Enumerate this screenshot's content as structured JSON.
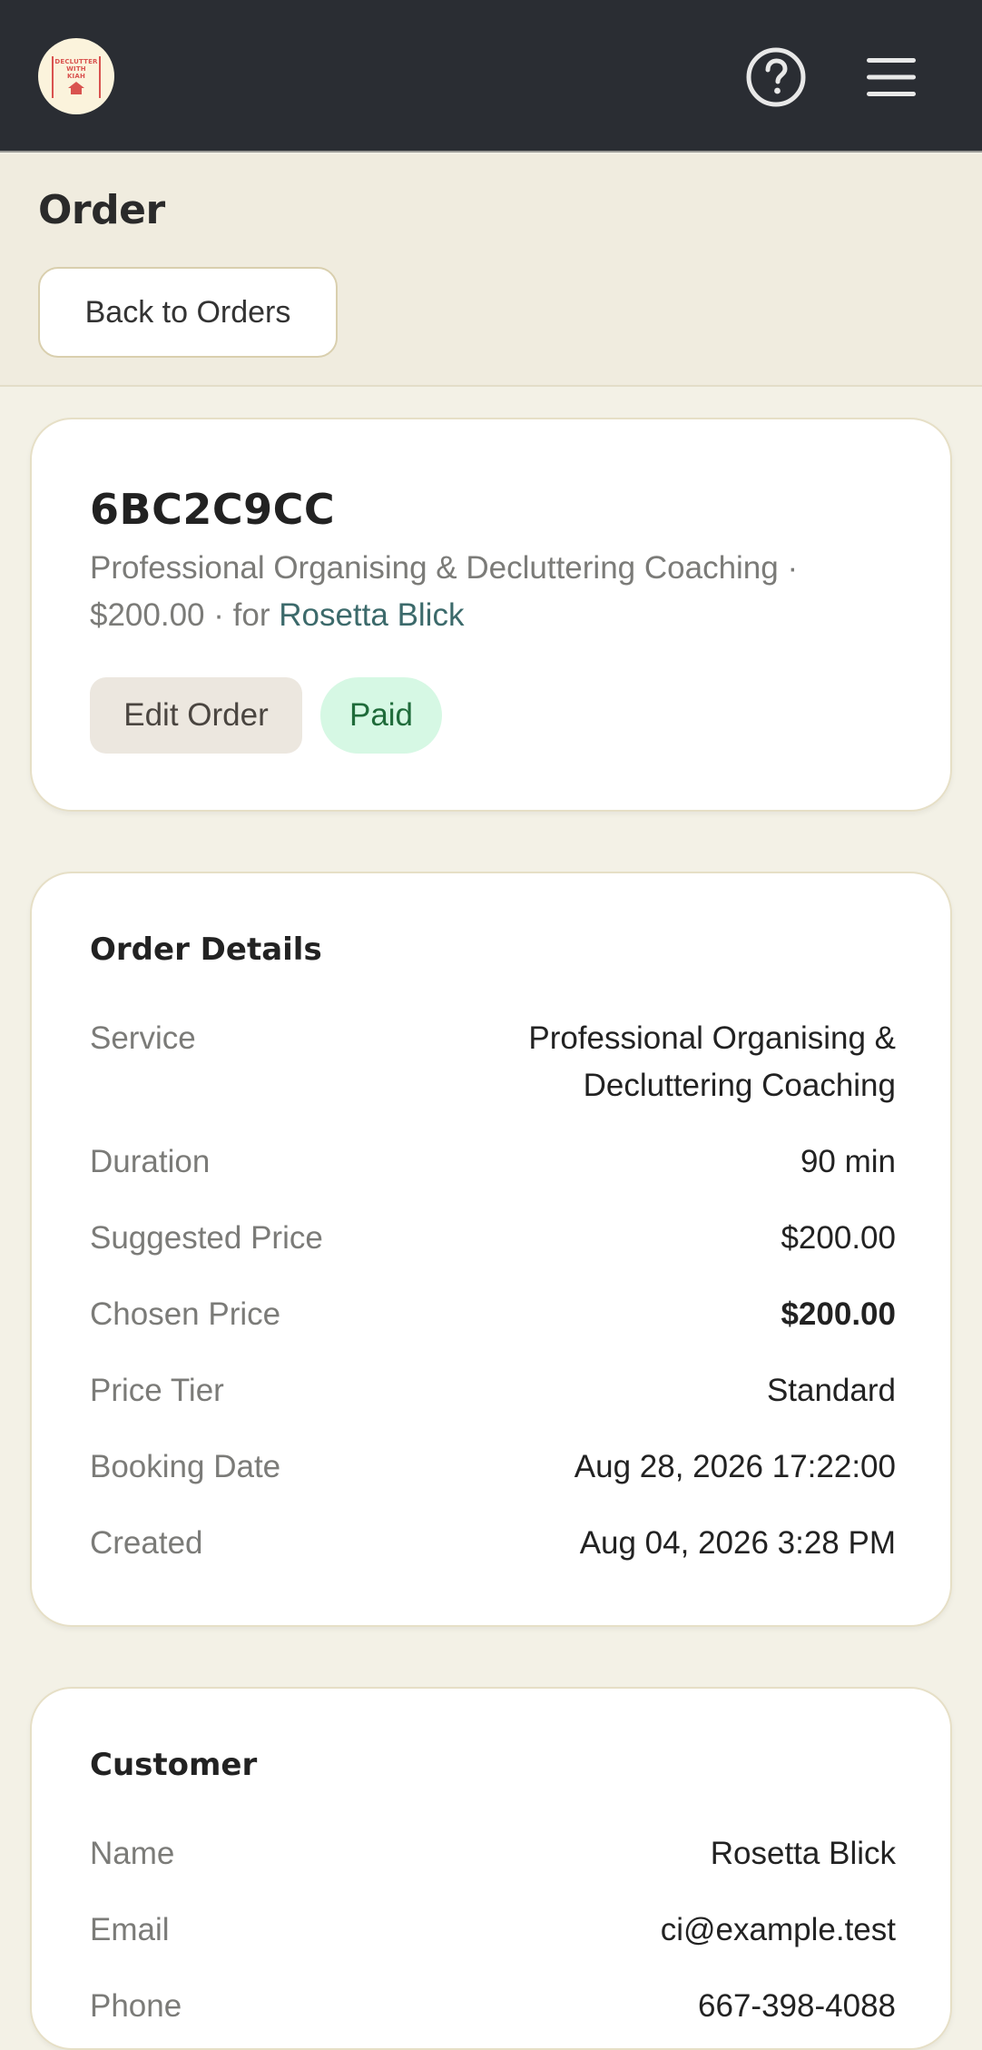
{
  "app": {
    "logo_text": "DECLUTTER WITH KIAH"
  },
  "header": {
    "title": "Order",
    "back_label": "Back to Orders"
  },
  "order": {
    "code": "6BC2C9CC",
    "service": "Professional Organising & Decluttering Coaching",
    "sep1": " · ",
    "price": "$200.00",
    "sep2": " · for ",
    "customer": "Rosetta Blick",
    "edit_label": "Edit Order",
    "status": "Paid"
  },
  "details": {
    "title": "Order Details",
    "rows": [
      {
        "label": "Service",
        "value": "Professional Organising & Decluttering Coaching"
      },
      {
        "label": "Duration",
        "value": "90 min"
      },
      {
        "label": "Suggested Price",
        "value": "$200.00"
      },
      {
        "label": "Chosen Price",
        "value": "$200.00"
      },
      {
        "label": "Price Tier",
        "value": "Standard"
      },
      {
        "label": "Booking Date",
        "value": "Aug 28, 2026 17:22:00"
      },
      {
        "label": "Created",
        "value": "Aug 04, 2026 3:28 PM"
      }
    ]
  },
  "customer": {
    "title": "Customer",
    "rows": [
      {
        "label": "Name",
        "value": "Rosetta Blick"
      },
      {
        "label": "Email",
        "value": "ci@example.test"
      },
      {
        "label": "Phone",
        "value": "667-398-4088"
      }
    ]
  },
  "icons": {
    "help": "help-circle-icon",
    "menu": "hamburger-menu-icon"
  },
  "colors": {
    "topbar": "#2a2d33",
    "background": "#f3f1e6",
    "link": "#3c6a6b",
    "paid_bg": "#d6f8e4",
    "paid_text": "#1f6b3a"
  }
}
